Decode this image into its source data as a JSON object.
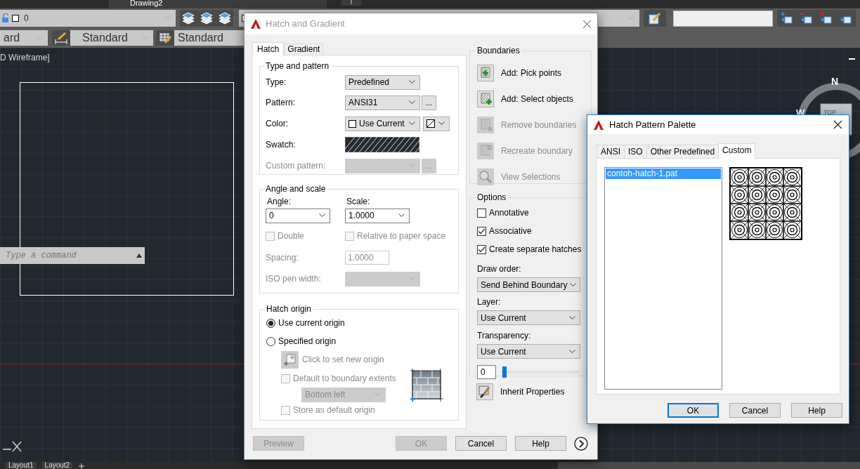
{
  "app": {
    "document_tab": "Drawing2",
    "layer": {
      "value": "0"
    },
    "styles": [
      {
        "value": "ard"
      },
      {
        "value": "Standard"
      },
      {
        "value": "Standard"
      }
    ],
    "viewport_label": "D Wireframe]",
    "command_line": {
      "placeholder": "Type a command"
    },
    "viewcube": {
      "north": "N",
      "west": "W",
      "top": "TOP"
    },
    "layout_tabs": [
      {
        "label": "Layout1"
      },
      {
        "label": "Layout2"
      }
    ]
  },
  "hatch_dialog": {
    "title": "Hatch and Gradient",
    "tabs": [
      {
        "label": "Hatch",
        "selected": true
      },
      {
        "label": "Gradient",
        "selected": false
      }
    ],
    "type_and_pattern": {
      "title": "Type and pattern",
      "type": {
        "label": "Type:",
        "value": "Predefined"
      },
      "pattern": {
        "label": "Pattern:",
        "value": "ANSI31",
        "browse": "..."
      },
      "color": {
        "label": "Color:",
        "value": "Use Current"
      },
      "swatch": {
        "label": "Swatch:"
      },
      "custom_pattern": {
        "label": "Custom pattern:",
        "browse": "...",
        "disabled": true
      }
    },
    "angle_and_scale": {
      "title": "Angle and scale",
      "angle": {
        "label": "Angle:",
        "value": "0"
      },
      "scale": {
        "label": "Scale:",
        "value": "1.0000"
      },
      "double": {
        "label": "Double",
        "checked": false,
        "disabled": true
      },
      "relative": {
        "label": "Relative to paper space",
        "checked": false,
        "disabled": true
      },
      "spacing": {
        "label": "Spacing:",
        "value": "1.0000",
        "disabled": true
      },
      "iso_pen_width": {
        "label": "ISO pen width:",
        "disabled": true
      }
    },
    "hatch_origin": {
      "title": "Hatch origin",
      "options": [
        {
          "label": "Use current origin",
          "selected": true
        },
        {
          "label": "Specified origin",
          "selected": false
        }
      ],
      "set_origin": {
        "label": "Click to set new origin",
        "disabled": true
      },
      "default_extents": {
        "label": "Default to boundary extents",
        "checked": false,
        "disabled": true
      },
      "extents_position": {
        "value": "Bottom left",
        "disabled": true
      },
      "store_default": {
        "label": "Store as default origin",
        "checked": false,
        "disabled": true
      }
    },
    "boundaries": {
      "title": "Boundaries",
      "actions": [
        {
          "kind": "pick",
          "label": "Add: Pick points",
          "disabled": false
        },
        {
          "kind": "select",
          "label": "Add: Select objects",
          "disabled": false
        },
        {
          "kind": "remove",
          "label": "Remove boundaries",
          "disabled": true
        },
        {
          "kind": "recreate",
          "label": "Recreate boundary",
          "disabled": true
        },
        {
          "kind": "view",
          "label": "View Selections",
          "disabled": true
        }
      ]
    },
    "options": {
      "title": "Options",
      "checkboxes": [
        {
          "label": "Annotative",
          "checked": false
        },
        {
          "label": "Associative",
          "checked": true
        },
        {
          "label": "Create separate hatches",
          "checked": true
        }
      ],
      "draw_order": {
        "label": "Draw order:",
        "value": "Send Behind Boundary"
      },
      "layer": {
        "label": "Layer:",
        "value": "Use Current"
      },
      "transparency": {
        "label": "Transparency:",
        "value": "Use Current",
        "reading": "0",
        "level": 0
      }
    },
    "inherit": {
      "label": "Inherit Properties"
    },
    "buttons": [
      {
        "label": "Preview",
        "disabled": true
      },
      {
        "label": "OK",
        "disabled": true
      },
      {
        "label": "Cancel",
        "disabled": false
      },
      {
        "label": "Help",
        "disabled": false
      }
    ]
  },
  "palette": {
    "title": "Hatch Pattern Palette",
    "tabs": [
      {
        "label": "ANSI",
        "selected": false
      },
      {
        "label": "ISO",
        "selected": false
      },
      {
        "label": "Other Predefined",
        "selected": false
      },
      {
        "label": "Custom",
        "selected": true
      }
    ],
    "files": [
      {
        "label": "contoh-hatch-1.pat",
        "selected": true
      }
    ],
    "buttons": [
      {
        "label": "OK",
        "default": true
      },
      {
        "label": "Cancel",
        "default": false
      },
      {
        "label": "Help",
        "default": false
      }
    ]
  }
}
